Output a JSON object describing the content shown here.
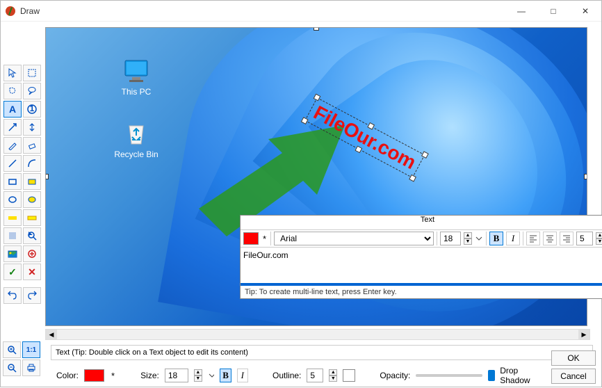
{
  "window": {
    "title": "Draw",
    "minimize": "—",
    "maximize": "□",
    "close": "✕"
  },
  "tools": {
    "pointer": "pointer",
    "marquee": "marquee",
    "freehand": "freehand",
    "callout": "callout",
    "text": "A",
    "number": "①",
    "arrow": "arrow",
    "arrow2": "arrow2",
    "pencil": "pencil",
    "eraser": "eraser",
    "line": "line",
    "curve": "curve",
    "rect": "rect",
    "rect_fill": "rect_fill",
    "ellipse": "ellipse",
    "ellipse_fill": "ellipse_fill",
    "highlight": "highlight",
    "highlight2": "highlight2",
    "blur": "blur",
    "magnify": "magnify",
    "image": "image",
    "cursor": "cursor",
    "check": "✓",
    "cross": "✕",
    "undo": "undo",
    "redo": "redo"
  },
  "canvas": {
    "desktop_icons": {
      "this_pc": "This PC",
      "recycle_bin": "Recycle Bin"
    },
    "text_object": "FileOur.com"
  },
  "text_panel": {
    "title": "Text",
    "close": "✕",
    "color": "#ff0000",
    "asterisk": "*",
    "font": "Arial",
    "size": "18",
    "spacing": "5",
    "content": "FileOur.com",
    "tip": "Tip: To create multi-line text, press Enter key."
  },
  "bottom": {
    "hint": "Text (Tip: Double click on a Text object to edit its content)",
    "color_label": "Color:",
    "color_value": "#ff0000",
    "asterisk": "*",
    "size_label": "Size:",
    "size_value": "18",
    "outline_label": "Outline:",
    "outline_value": "5",
    "opacity_label": "Opacity:",
    "opacity_pct": 90,
    "dropshadow_label": "Drop Shadow",
    "ok": "OK",
    "cancel": "Cancel"
  },
  "zoom": {
    "zoom_in": "+",
    "one_to_one": "1:1",
    "zoom_out": "−",
    "print": "print"
  }
}
